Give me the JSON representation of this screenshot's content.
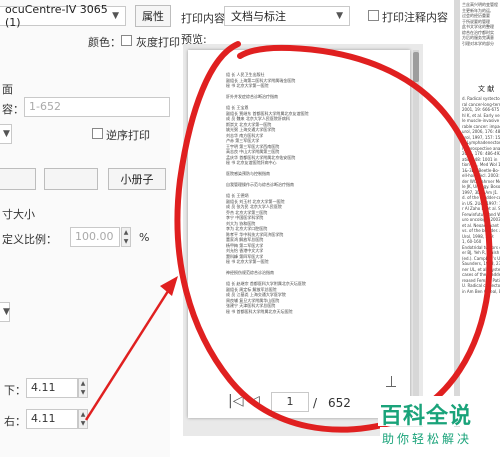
{
  "printer": {
    "name": "ocuCentre-IV 3065 (1)",
    "properties_button": "属性"
  },
  "color": {
    "label": "颜色：",
    "grayscale_label": "灰度打印"
  },
  "print_content": {
    "label": "打印内容:",
    "value": "文档与标注",
    "print_annotations_label": "打印注释内容"
  },
  "preview": {
    "label": "预览:"
  },
  "range": {
    "pages_placeholder": "1-652",
    "reverse_label": "逆序打印",
    "booklet_button": "小册子",
    "fragment_label_1": "面",
    "fragment_label_2": "容："
  },
  "scale": {
    "size_label": "寸大小",
    "custom_label": "定义比例：",
    "value": "100.00",
    "unit": "%"
  },
  "margins": {
    "bottom_label": "下：",
    "bottom_value": "4.11",
    "right_label": "右：",
    "right_value": "4.11"
  },
  "pagination": {
    "current": "1",
    "separator": "/",
    "total": "652"
  },
  "doc_page": {
    "lines": [
      "组   长  人民卫生出版社",
      "副组长  上海第二医科大学附属瑞金医院",
      "秘   书  北京大学第一医院",
      "",
      "肝外并发症综合诊断治疗指南",
      "",
      "组   长  王宝恩",
      "副组长  贾继东  首都医科大学附属北京友谊医院",
      "成   员  魏来  北京大学人民医院肝病科",
      "          斯崇文  北京大学第一医院",
      "          姚光弼  上海交通大学医学院",
      "          刘志华  南方医科大学",
      "          卢赤  第三军医大学",
      "          王宇明  第三军医大学西南医院",
      "          高志良  中山大学附属第三医院",
      "          孟庆华  首都医科大学附属北京佑安医院",
      "秘   书  北京友谊医院肝病中心",
      "",
      "医院感染预防与控制指南",
      "",
      "自我管理操作示范与综合诊断治疗指南",
      "",
      "组   长  王德炳",
      "副组长  刘玉村  北京大学第一医院",
      "成   员  张为民  北京大学人民医院",
      "          乔杰  北京大学第三医院",
      "          李宁  中国医学科学院",
      "          刘大为  协和医院",
      "          李为  北京大学口腔医院",
      "          陈孝平  华中科技大学同济医学院",
      "          董家鸿  解放军总医院",
      "          杨甲梅  第二军医大学",
      "          刘允怡  香港中文大学",
      "          窦科峰  第四军医大学",
      "秘   书  北京大学第一医院",
      "",
      "神经损伤规范综合诊治指南",
      "",
      "组   长  赵继宗  首都医科大学附属北京天坛医院",
      "副组长  周定标  解放军总医院",
      "成   员  江基尧  上海交通大学医学院",
      "          周良辅  复旦大学附属华山医院",
      "          张建宁  天津医科大学总医院",
      "秘   书  首都医科大学附属北京天坛医院"
    ]
  },
  "right_doc": {
    "heading": "文  献",
    "lines": [
      "d. Radical systectomy",
      "ral cancer-long-term re-",
      "2001, 19: 666-675",
      "hl K, et al. Early versus",
      "le muscle-invasive blad-",
      "rable cancer: impact of",
      "urol, 2006, 176: 486-492",
      "urol, 1997, 157: 1587",
      "1. Lymphadenectomy at",
      "ry: prospective analysis",
      "2006, 176: 486-492",
      "ation, 48: 1001 in",
      "tion 80 , Med Wol 1(1)",
      "1&-3DE Beetle-Bo-",
      "ell-hole Tecl. 2003:",
      "der WC, Fahrner Mer.",
      "le JK, Urology. Bosone",
      "1997, 3DE, Am J1. Erick",
      "d. of the bladder-cortical",
      "in US. 2Ucl, 1997: 159, 6.1",
      "r Al Zaho B, et al. SAC-",
      "Ferwinfuture and Wo-rk",
      "uro oncology, 2003,",
      "et al. Neoadjuvant",
      "vs. of the bladder. a",
      "Urol, 1998, 159:",
      "1, 60-160",
      "Endotridal tumors of",
      "er BJ, Yeh R, Walsh PC",
      "(ed.). Campbell's Urolo-",
      "Saunders, 1998, 2359",
      "ner UL, et al. Cystectomy",
      "cases of the bladder and",
      "reased Female Patients, KAL.",
      "U. Radical cystectomy",
      "in Am Ben Oweal, Bladde..."
    ],
    "top_lines": [
      "兰丝高兴明的变管程",
      "主更新年为的运,",
      "过会的经历重要",
      "于所说要的管理",
      "此书文学化的整理",
      "综合在治疗都时实",
      "方后的服务完满意",
      "引理对本学的部分"
    ]
  },
  "watermark": {
    "main": "百科全说",
    "sub": "助你轻松解决"
  },
  "colors": {
    "annotation_red": "#e02020",
    "watermark_green": "#1aa37a"
  }
}
